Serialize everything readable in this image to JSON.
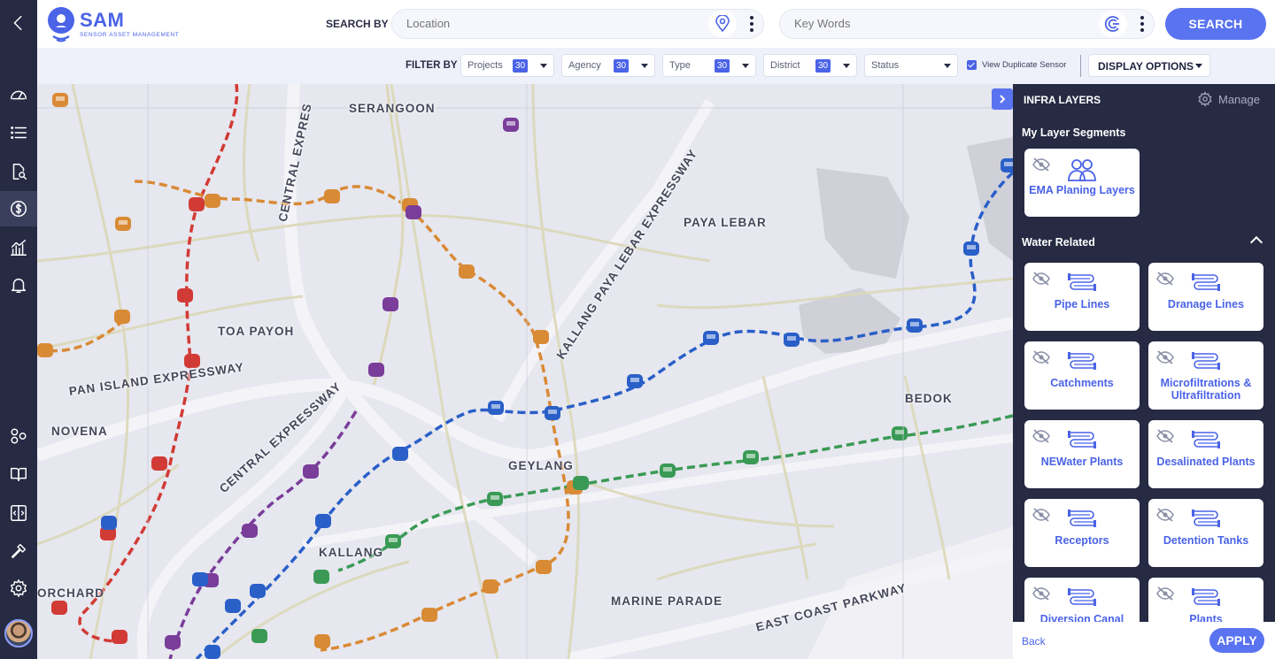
{
  "app": {
    "title": "SAM",
    "subtitle": "SENSOR ASSET MANAGEMENT"
  },
  "rail": {
    "icons": [
      "back-chevron-icon",
      "dashboard-gauge-icon",
      "list-icon",
      "document-search-icon",
      "dollar-icon",
      "analytics-chart-icon",
      "bell-icon",
      "hexagon-network-icon",
      "book-icon",
      "expand-arrows-icon",
      "hammer-icon",
      "gear-icon"
    ]
  },
  "search": {
    "label": "SEARCH BY",
    "location_placeholder": "Location",
    "keywords_placeholder": "Key Words",
    "button_label": "SEARCH"
  },
  "filters": {
    "label": "FILTER BY",
    "items": [
      {
        "label": "Projects",
        "count": "30"
      },
      {
        "label": "Agency",
        "count": "30"
      },
      {
        "label": "Type",
        "count": "30"
      },
      {
        "label": "District",
        "count": "30"
      },
      {
        "label": "Status",
        "count": ""
      }
    ],
    "duplicate_label": "View Duplicate Sensor",
    "duplicate_checked": true,
    "display_options_label": "DISPLAY OPTIONS"
  },
  "map": {
    "labels": [
      "SERANGOON",
      "PAYA LEBAR",
      "TOA PAYOH",
      "PAN ISLAND EXPRESSWAY",
      "NOVENA",
      "GEYLANG",
      "BEDOK",
      "KALLANG",
      "MARINE PARADE",
      "EAST COAST PARKWAY",
      "ORCHARD",
      "CENTRAL EXPRESSWAY",
      "CENTRAL EXPRES",
      "KALLANG PAYA LEBAR EXPRESSWAY"
    ]
  },
  "panel": {
    "title": "INFRA LAYERS",
    "manage_label": "Manage",
    "my_segments_title": "My Layer Segments",
    "my_segments": [
      {
        "label": "EMA Planing Layers",
        "icon": "users-group-icon"
      }
    ],
    "water_title": "Water Related",
    "water_items": [
      {
        "label": "Pipe Lines"
      },
      {
        "label": "Dranage Lines"
      },
      {
        "label": "Catchments"
      },
      {
        "label": "Microfiltrations & Ultrafiltration"
      },
      {
        "label": "NEWater Plants"
      },
      {
        "label": "Desalinated Plants"
      },
      {
        "label": "Receptors"
      },
      {
        "label": "Detention Tanks"
      },
      {
        "label": "Diversion Canal"
      },
      {
        "label": "Plants"
      }
    ],
    "back_label": "Back",
    "apply_label": "APPLY"
  },
  "colors": {
    "accent": "#5a73f0",
    "rail": "#262a43",
    "line_red": "#d23a35",
    "line_orange": "#d98a35",
    "line_blue": "#2a5fc8",
    "line_green": "#3a9a55",
    "line_purple": "#7a3d9a"
  }
}
